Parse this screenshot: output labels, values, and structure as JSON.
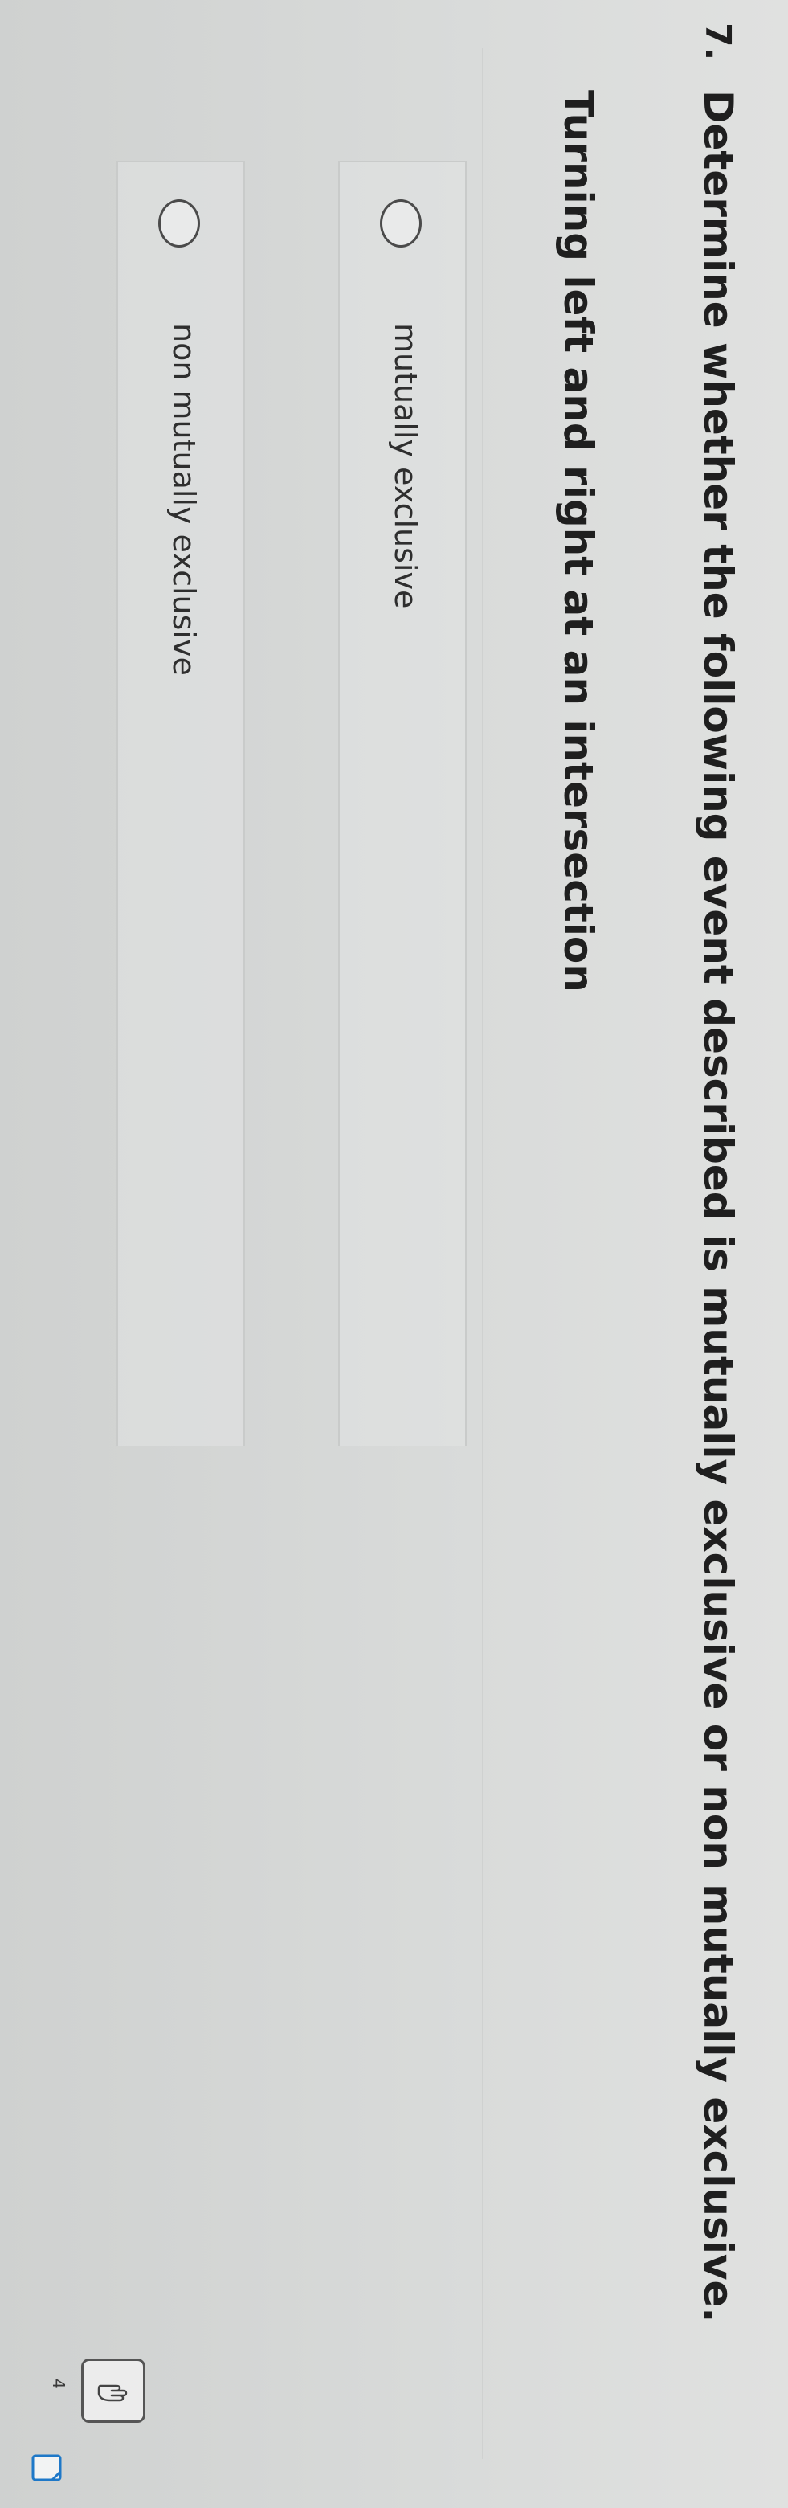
{
  "question": {
    "number": "7.",
    "prompt": "Determine whether the following event described is mutually exclusive or non mutually exclusive.",
    "event": "Turning left and right at an intersection"
  },
  "options": [
    {
      "label": "mutually exclusive",
      "selected": false
    },
    {
      "label": "non mutually exclusive",
      "selected": false
    }
  ],
  "corner": {
    "badge": "4"
  },
  "icons": {
    "feedback": "hand-pointer-icon",
    "corner": "document-icon"
  }
}
